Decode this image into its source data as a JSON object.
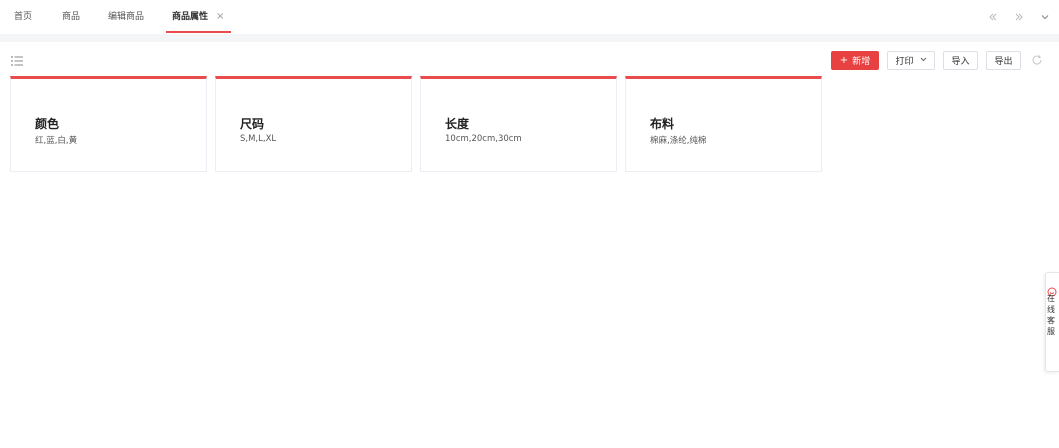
{
  "tabs": [
    {
      "label": "首页",
      "active": false
    },
    {
      "label": "商品",
      "active": false
    },
    {
      "label": "编辑商品",
      "active": false
    },
    {
      "label": "商品属性",
      "active": true,
      "closable": true
    }
  ],
  "tab_close_glyph": "×",
  "tab_tools": [
    "close-left-icon",
    "close-right-icon",
    "chevron-down-icon"
  ],
  "toolbar": {
    "add_label": "新增",
    "print_label": "打印",
    "import_label": "导入",
    "export_label": "导出"
  },
  "attributes": [
    {
      "name": "颜色",
      "values": "红,蓝,白,黄"
    },
    {
      "name": "尺码",
      "values": "S,M,L,XL"
    },
    {
      "name": "长度",
      "values": "10cm,20cm,30cm"
    },
    {
      "name": "布料",
      "values": "棉麻,涤纶,纯棉"
    }
  ],
  "side_widget": {
    "text": "在线客服"
  },
  "colors": {
    "accent": "#e84c4c",
    "primary_button": "#e84141",
    "band": "#f4f5f7"
  }
}
